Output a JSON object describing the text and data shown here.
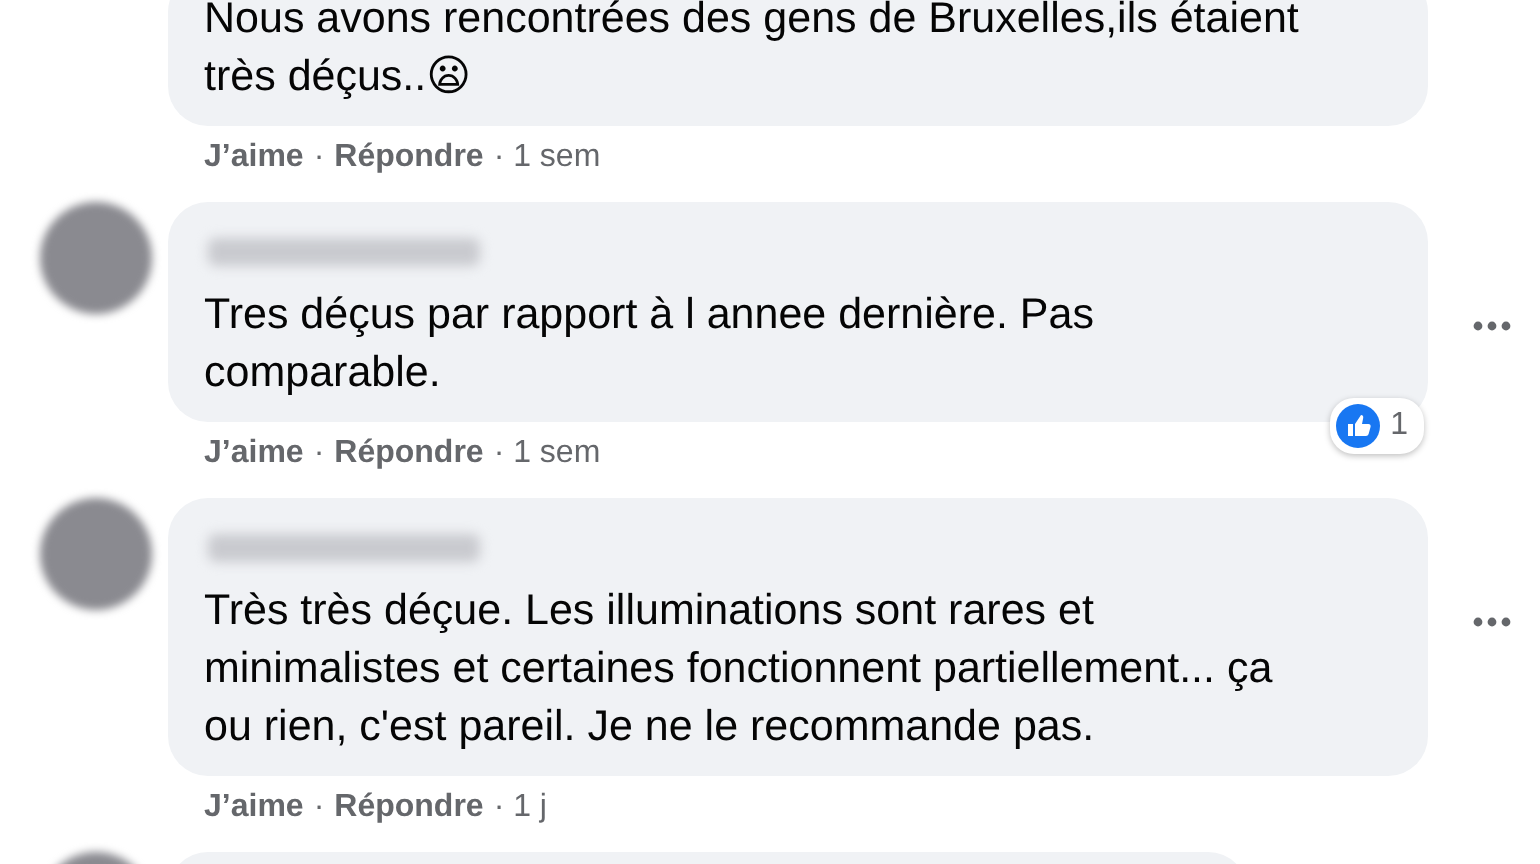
{
  "comments": [
    {
      "kind": "full",
      "text": "Nous avons rencontrées des gens de Bruxelles,ils étaient\ntrès déçus..😦",
      "like": "J’aime",
      "sep": "·",
      "reply": "Répondre",
      "time": "· 1 sem"
    },
    {
      "kind": "full",
      "author_hidden": true,
      "avatar": true,
      "text": "Tres déçus par rapport à l annee dernière. Pas\ncomparable.",
      "menu": true,
      "reaction_count": "1",
      "like": "J’aime",
      "sep": "·",
      "reply": "Répondre",
      "time": "· 1 sem"
    },
    {
      "kind": "full",
      "author_hidden": true,
      "avatar": true,
      "text": "Très très déçue. Les illuminations sont rares et\nminimalistes et certaines fonctionnent partiellement... ça\nou rien, c'est pareil. Je ne le recommande pas.",
      "menu": true,
      "like": "J’aime",
      "sep": "·",
      "reply": "Répondre",
      "time": "· 1 j"
    },
    {
      "kind": "cut",
      "avatar": true
    }
  ]
}
